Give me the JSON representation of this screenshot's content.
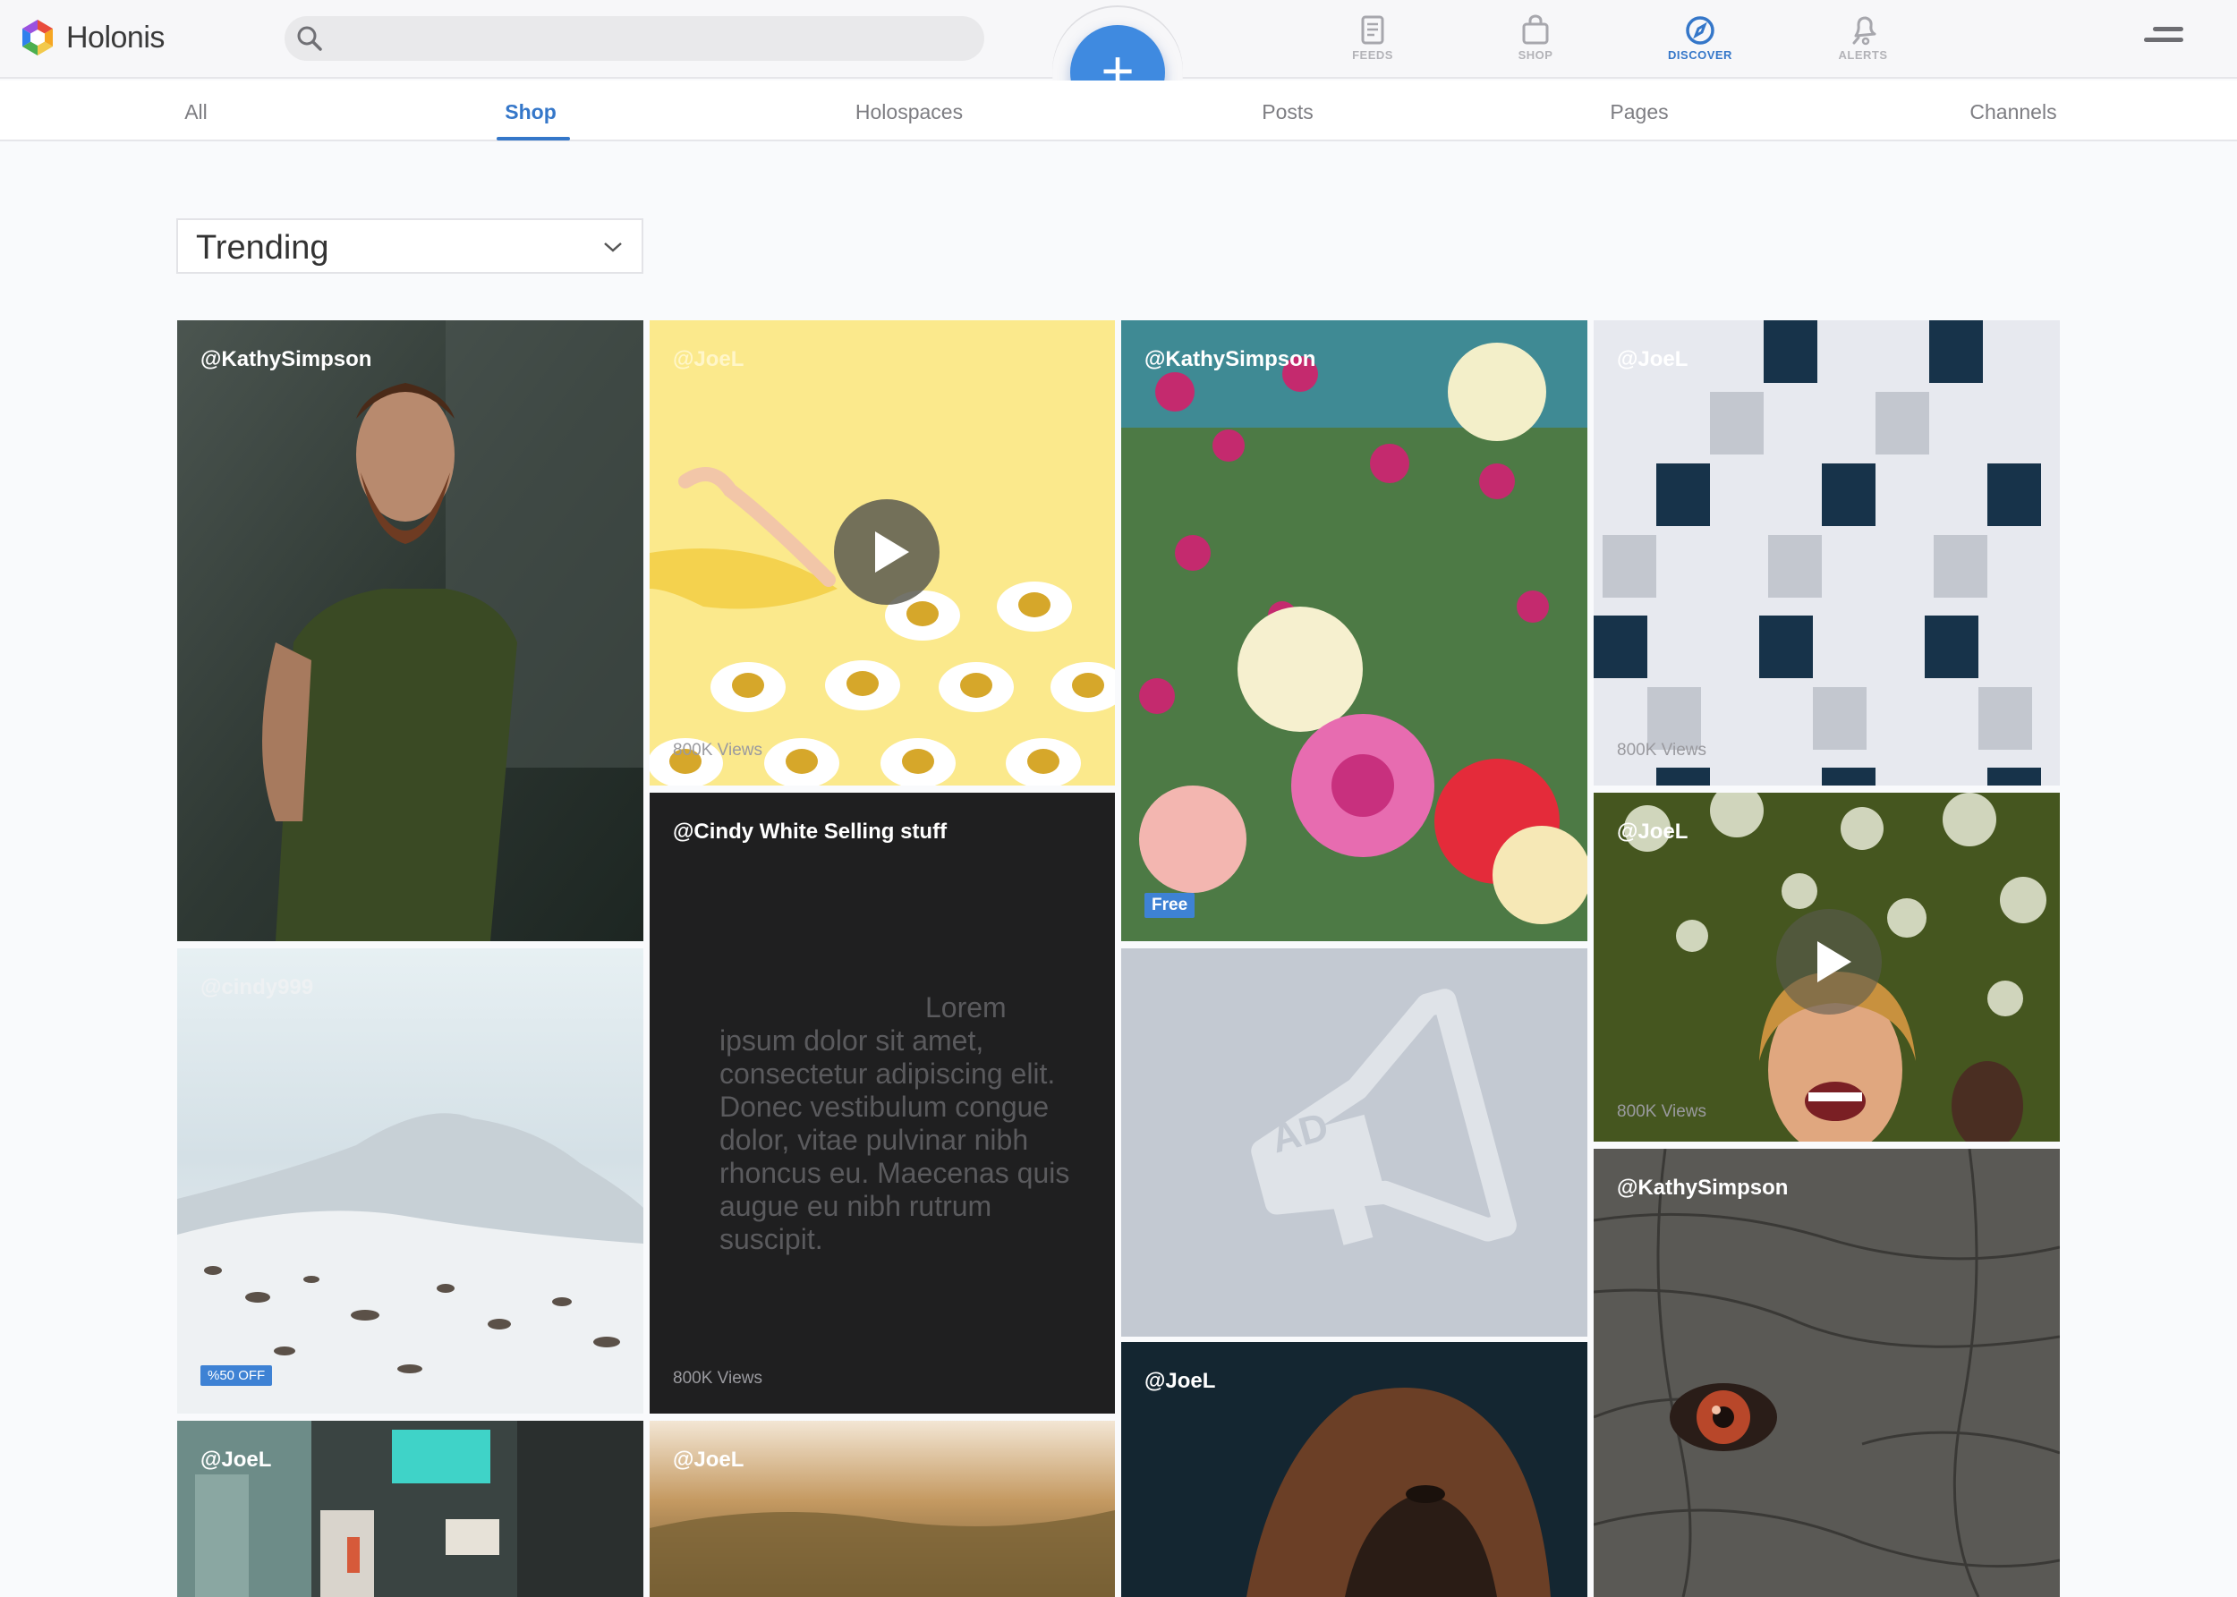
{
  "app": {
    "name": "Holonis"
  },
  "search": {
    "value": ""
  },
  "header": {
    "nav": [
      {
        "label": "FEEDS",
        "icon": "feeds-icon"
      },
      {
        "label": "SHOP",
        "icon": "shop-bag-icon"
      },
      {
        "label": "DISCOVER",
        "icon": "compass-icon",
        "active": true
      },
      {
        "label": "ALERTS",
        "icon": "bell-icon"
      }
    ],
    "fab_label": "+"
  },
  "tabs": [
    {
      "label": "All"
    },
    {
      "label": "Shop",
      "active": true
    },
    {
      "label": "Holospaces"
    },
    {
      "label": "Posts"
    },
    {
      "label": "Pages"
    },
    {
      "label": "Channels"
    }
  ],
  "sort": {
    "selected": "Trending"
  },
  "colors": {
    "accent": "#3f8ae0",
    "active_text": "#3577c9",
    "badge": "#3e82d4",
    "ad_bg": "#c3c9d2"
  },
  "tiles": {
    "t1": {
      "handle": "@KathySimpson",
      "subject": "man-in-green-shirt-photo"
    },
    "t2": {
      "handle": "@JoeL",
      "views": "800K Views",
      "subject": "fried-eggs-yellow-video"
    },
    "t3": {
      "handle": "@KathySimpson",
      "badge": "Free",
      "subject": "flowers-bouquet-photo"
    },
    "t4": {
      "handle": "@JoeL",
      "views": "800K Views",
      "subject": "white-building-windows-photo"
    },
    "t5": {
      "handle": "@cindy999",
      "badge": "%50 OFF",
      "subject": "snowy-mountain-photo"
    },
    "t6": {
      "handle": "@Cindy White Selling stuff",
      "text": "Lorem ipsum dolor sit amet, consectetur adipiscing elit. Donec vestibulum congue dolor, vitae pulvinar nibh rhoncus eu. Maecenas quis augue eu nibh rutrum suscipit.",
      "views": "800K Views"
    },
    "t7": {
      "ad_label": "AD",
      "subject": "advertisement-placeholder"
    },
    "t8": {
      "handle": "@JoeL",
      "views": "800K Views",
      "subject": "laughing-woman-video"
    },
    "t9": {
      "handle": "@KathySimpson",
      "subject": "elephant-eye-photo"
    },
    "t10": {
      "handle": "@JoeL",
      "subject": "city-street-photo"
    },
    "t11": {
      "handle": "@JoeL",
      "subject": "misty-forest-photo"
    },
    "t12": {
      "handle": "@JoeL",
      "subject": "gorilla-photo"
    }
  }
}
